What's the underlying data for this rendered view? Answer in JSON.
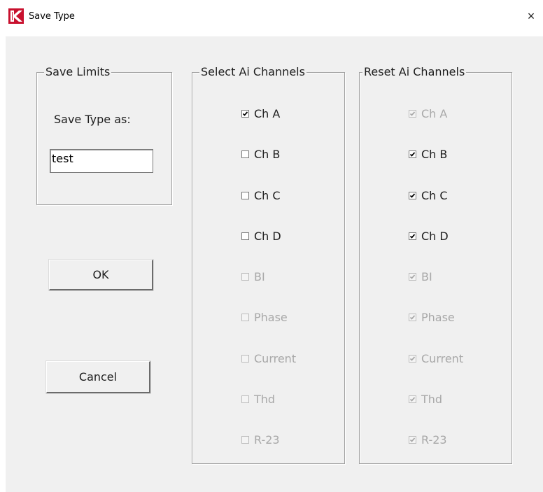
{
  "window": {
    "title": "Save Type",
    "close_glyph": "×",
    "icon": "red-k-logo-icon"
  },
  "save_limits": {
    "group_title": "Save  Limits",
    "prompt": "Save Type as:",
    "value": "test"
  },
  "buttons": {
    "ok": "OK",
    "cancel": "Cancel"
  },
  "select_channels": {
    "group_title": "Select Ai Channels",
    "items": [
      {
        "label": "Ch A",
        "checked": true,
        "enabled": true
      },
      {
        "label": "Ch B",
        "checked": false,
        "enabled": true
      },
      {
        "label": "Ch C",
        "checked": false,
        "enabled": true
      },
      {
        "label": "Ch D",
        "checked": false,
        "enabled": true
      },
      {
        "label": "BI",
        "checked": false,
        "enabled": false
      },
      {
        "label": "Phase",
        "checked": false,
        "enabled": false
      },
      {
        "label": "Current",
        "checked": false,
        "enabled": false
      },
      {
        "label": "Thd",
        "checked": false,
        "enabled": false
      },
      {
        "label": "R-23",
        "checked": false,
        "enabled": false
      }
    ]
  },
  "reset_channels": {
    "group_title": "Reset Ai Channels",
    "items": [
      {
        "label": "Ch A",
        "checked": true,
        "enabled": false
      },
      {
        "label": "Ch B",
        "checked": true,
        "enabled": true
      },
      {
        "label": "Ch C",
        "checked": true,
        "enabled": true
      },
      {
        "label": "Ch D",
        "checked": true,
        "enabled": true
      },
      {
        "label": "BI",
        "checked": true,
        "enabled": false
      },
      {
        "label": "Phase",
        "checked": true,
        "enabled": false
      },
      {
        "label": "Current",
        "checked": true,
        "enabled": false
      },
      {
        "label": "Thd",
        "checked": true,
        "enabled": false
      },
      {
        "label": "R-23",
        "checked": true,
        "enabled": false
      }
    ]
  }
}
